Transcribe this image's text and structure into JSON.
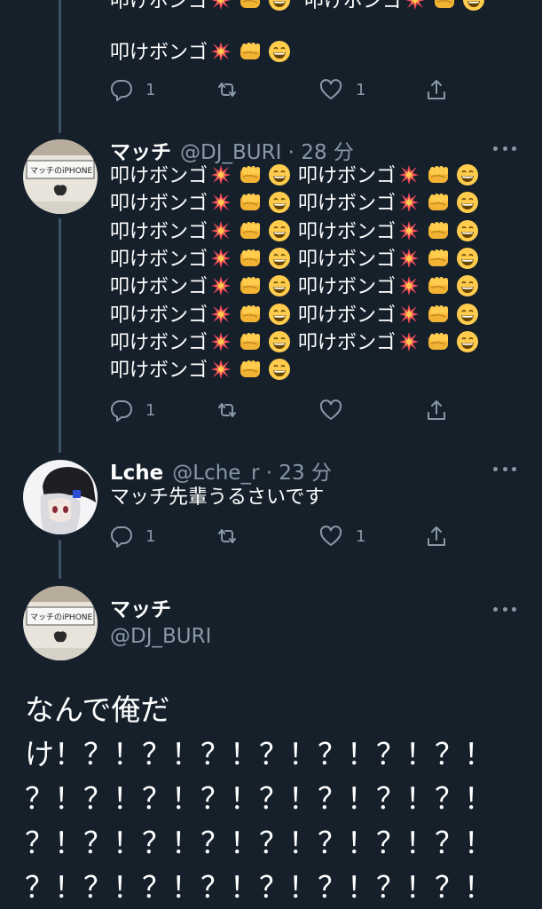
{
  "thread": {
    "tweet1": {
      "text_row1_a": "叩けボンゴ",
      "text_row1_b": "叩けボンゴ",
      "text_row2": "叩けボンゴ",
      "reply_count": "1",
      "like_count": "1"
    },
    "tweet2": {
      "name": "マッチ",
      "handle_time": "@DJ_BURI · 28 分",
      "rows_left": [
        "叩けボンゴ",
        "叩けボンゴ",
        "叩けボンゴ",
        "叩けボンゴ",
        "叩けボンゴ",
        "叩けボンゴ",
        "叩けボンゴ"
      ],
      "rows_right": [
        "叩けボンゴ",
        "叩けボンゴ",
        "叩けボンゴ",
        "叩けボンゴ",
        "叩けボンゴ",
        "叩けボンゴ",
        "叩けボンゴ"
      ],
      "last_row": "叩けボンゴ",
      "reply_count": "1"
    },
    "tweet3": {
      "name": "Lche",
      "handle_time": "@Lche_r · 23 分",
      "text": "マッチ先輩うるさいです",
      "reply_count": "1",
      "like_count": "1"
    },
    "main_tweet": {
      "name": "マッチ",
      "handle": "@DJ_BURI",
      "lines": [
        "なんで俺だ",
        "け！？！？！？！？！？！？！？！",
        "？！？！？！？！？！？！？！？！",
        "？！？！？！？！？！？！？！？！",
        "？！？！？！？！？！？！？！？！"
      ]
    }
  },
  "icons": {
    "reply": "reply-icon",
    "retweet": "retweet-icon",
    "like": "heart-icon",
    "share": "share-icon",
    "more": "more-icon",
    "emoji_burst": "collision-emoji",
    "emoji_fist": "fist-emoji",
    "emoji_grin": "grin-emoji"
  },
  "colors": {
    "background": "#15202b",
    "text": "#ffffff",
    "secondary": "#8899a6",
    "thread_line": "#3d5466"
  }
}
